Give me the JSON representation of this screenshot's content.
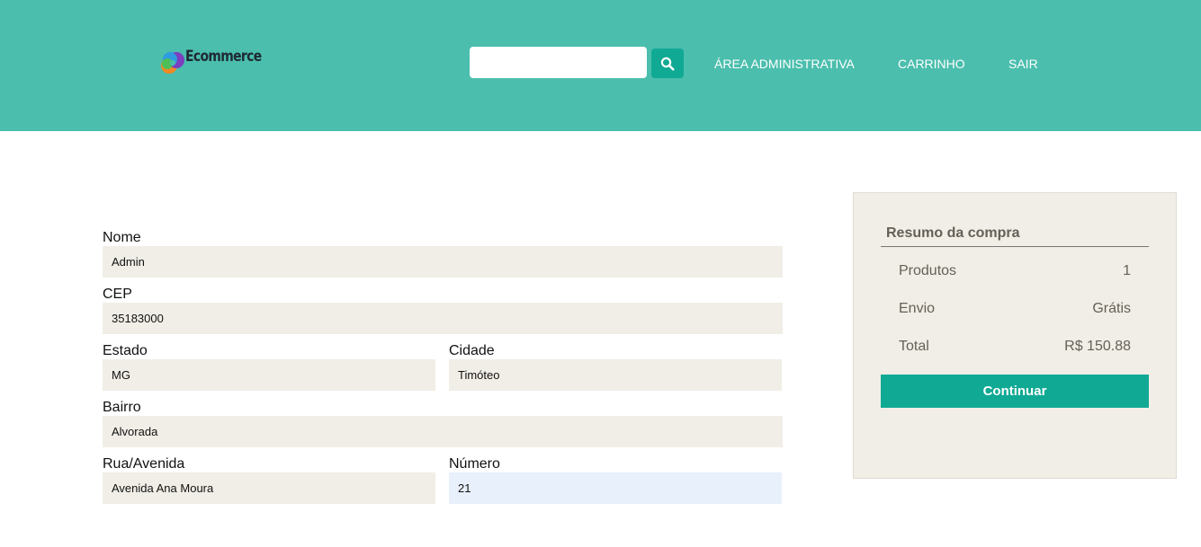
{
  "header": {
    "logo_text": "Ecommerce",
    "search": {
      "value": "",
      "placeholder": ""
    },
    "nav": [
      "ÁREA ADMINISTRATIVA",
      "CARRINHO",
      "SAIR"
    ]
  },
  "form": {
    "nome": {
      "label": "Nome",
      "value": "Admin"
    },
    "cep": {
      "label": "CEP",
      "value": "35183000"
    },
    "estado": {
      "label": "Estado",
      "value": "MG"
    },
    "cidade": {
      "label": "Cidade",
      "value": "Timóteo"
    },
    "bairro": {
      "label": "Bairro",
      "value": "Alvorada"
    },
    "rua": {
      "label": "Rua/Avenida",
      "value": "Avenida Ana Moura"
    },
    "numero": {
      "label": "Número",
      "value": "21"
    }
  },
  "summary": {
    "title": "Resumo da compra",
    "rows": [
      {
        "label": "Produtos",
        "value": "1"
      },
      {
        "label": "Envio",
        "value": "Grátis"
      },
      {
        "label": "Total",
        "value": "R$ 150.88"
      }
    ],
    "button_label": "Continuar"
  },
  "colors": {
    "header_bg": "#4bbead",
    "accent": "#10a994",
    "input_bg": "#f0eee6",
    "active_input_bg": "#e8f0fc"
  },
  "icons": {
    "search": "search-icon",
    "logo": "ecommerce-logo-icon"
  }
}
